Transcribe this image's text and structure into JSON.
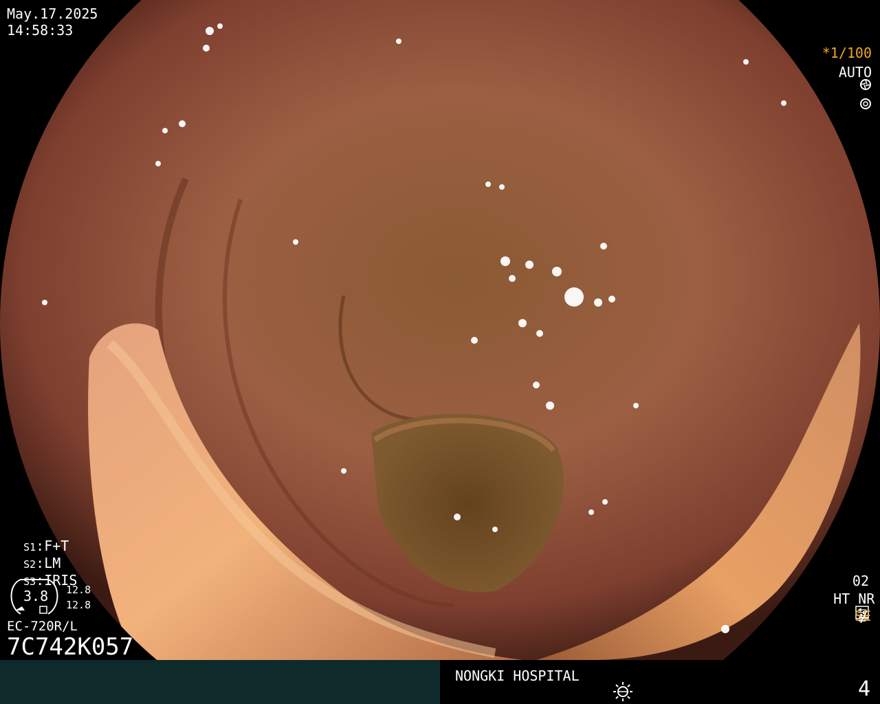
{
  "datetime": {
    "date": "May.17.2025",
    "time": "14:58:33"
  },
  "shutter": {
    "value": "*1/100",
    "icon": "shutter-icon"
  },
  "iris_mode": {
    "value": "AUTO",
    "icon": "iris-icon"
  },
  "switches": [
    {
      "key": "S1",
      "value": "F+T"
    },
    {
      "key": "S2",
      "value": "LM"
    },
    {
      "key": "S3",
      "value": "IRIS"
    }
  ],
  "zoom_gauge": {
    "value": "3.8",
    "upper": "12.8",
    "lower": "12.8"
  },
  "scope_model": "EC-720R/L",
  "serial_number": "7C742K057",
  "right_status": {
    "mode_number": "02",
    "ht": "HT",
    "nr": "NR",
    "se": "SE",
    "se_color": "#f5a623"
  },
  "hospital": "NONGKI HOSPITAL",
  "lamp_icon": "brightness-icon",
  "image_index": "4"
}
